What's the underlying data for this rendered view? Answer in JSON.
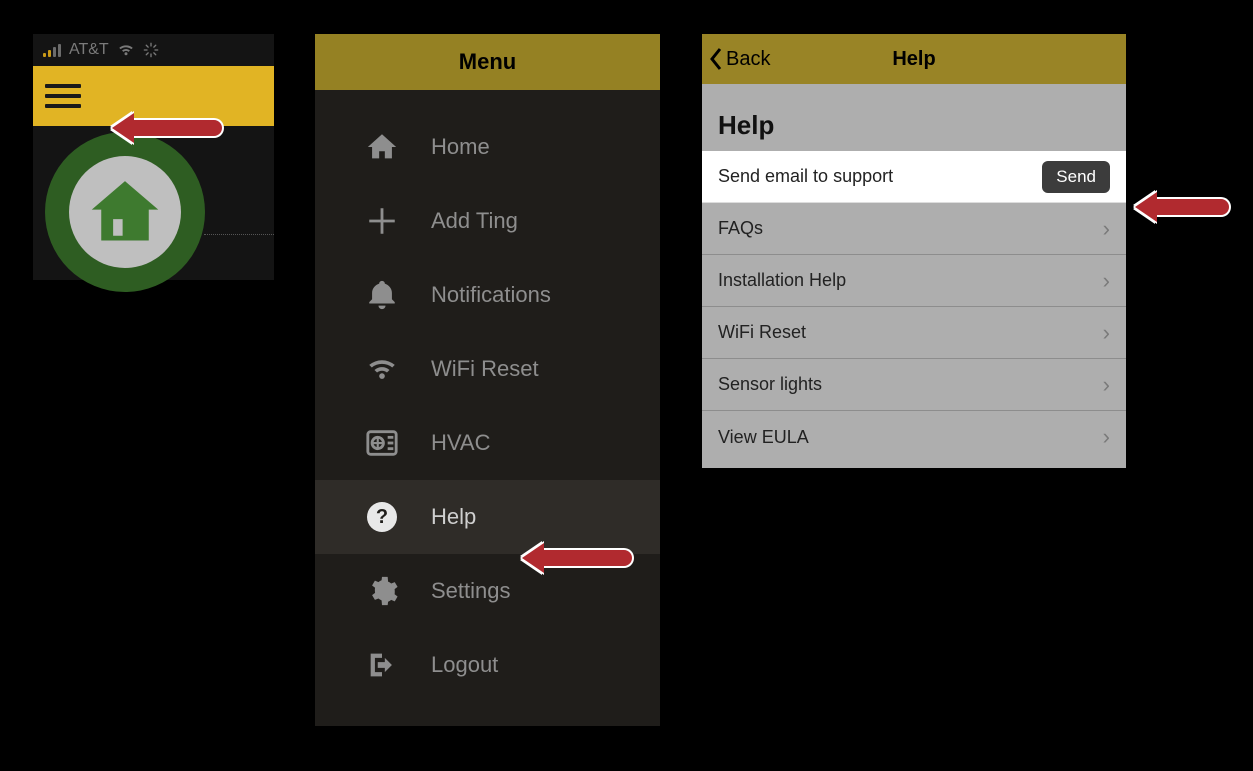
{
  "panel1": {
    "carrier": "AT&T"
  },
  "menu": {
    "title": "Menu",
    "items": [
      {
        "label": "Home"
      },
      {
        "label": "Add Ting"
      },
      {
        "label": "Notifications"
      },
      {
        "label": "WiFi Reset"
      },
      {
        "label": "HVAC"
      },
      {
        "label": "Help"
      },
      {
        "label": "Settings"
      },
      {
        "label": "Logout"
      }
    ]
  },
  "help": {
    "back_label": "Back",
    "nav_title": "Help",
    "heading": "Help",
    "send_row_label": "Send email to support",
    "send_button": "Send",
    "rows": [
      {
        "label": "FAQs"
      },
      {
        "label": "Installation Help"
      },
      {
        "label": "WiFi Reset"
      },
      {
        "label": "Sensor lights"
      },
      {
        "label": "View EULA"
      }
    ]
  }
}
